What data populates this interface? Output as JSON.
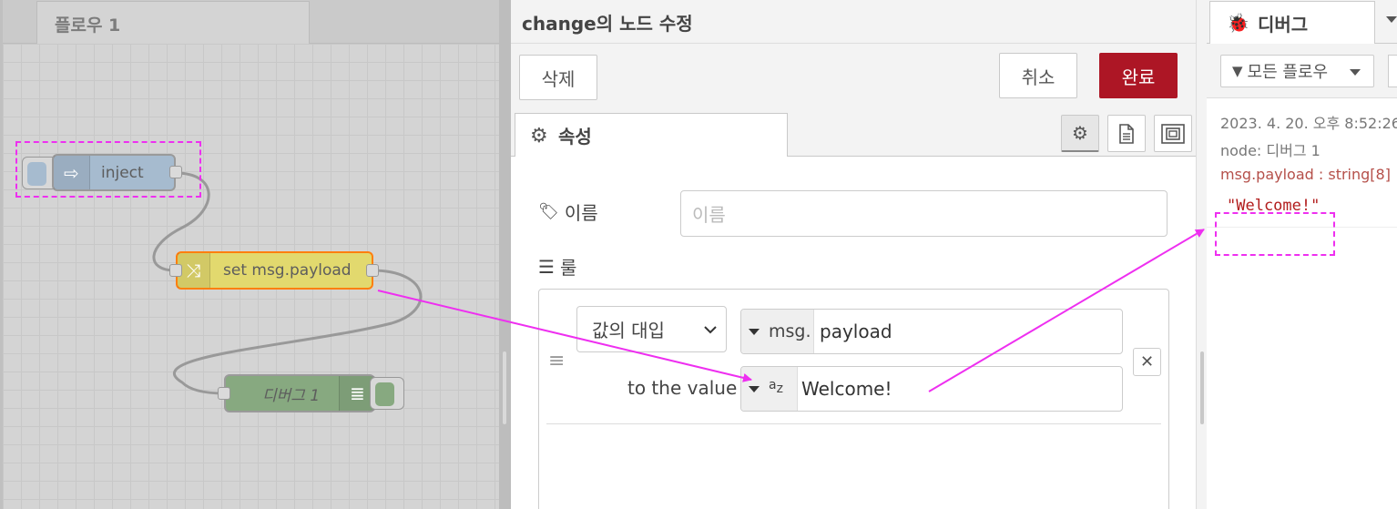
{
  "workspace": {
    "tab_label": "플로우 1",
    "nodes": {
      "inject": {
        "label": "inject",
        "color": "#a6bbcf"
      },
      "change": {
        "label": "set msg.payload",
        "color": "#e2d96e",
        "border": "#ff7f0e"
      },
      "debug": {
        "label": "디버그 1",
        "color": "#87a980"
      }
    }
  },
  "editor": {
    "title": "change의 노드 수정",
    "delete_label": "삭제",
    "cancel_label": "취소",
    "done_label": "완료",
    "properties_tab": "속성",
    "name_label": "이름",
    "name_placeholder": "이름",
    "rules_label": "룰",
    "rule": {
      "action": "값의 대입",
      "target_type": "msg.",
      "target_value": "payload",
      "to_label": "to the value",
      "value_type": "az",
      "value": "Welcome!"
    }
  },
  "debug": {
    "tab_label": "디버그",
    "filter_label": "모든 플로우",
    "message": {
      "timestamp": "2023. 4. 20. 오후 8:52:26",
      "node": "node: 디버그 1",
      "type": "msg.payload : string[8]",
      "value": "\"Welcome!\""
    }
  },
  "colors": {
    "accent": "#ad1625",
    "annotation": "#ee2ff0"
  }
}
